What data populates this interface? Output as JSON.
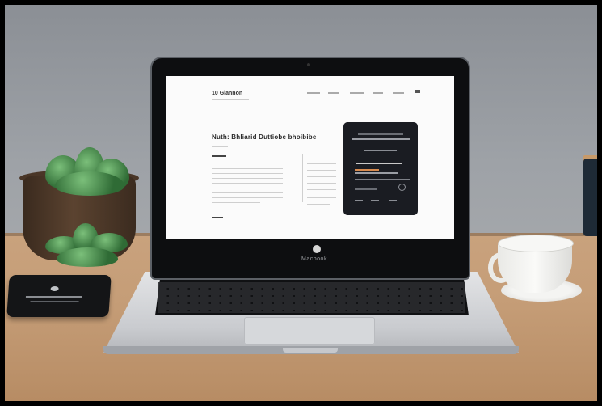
{
  "screen_page": {
    "logo": "10 Giannon",
    "heading": "Nuth: Bhliarid Duttiobe bhoibibe",
    "subhead": "Dhbabe"
  },
  "laptop": {
    "brand_text": "Macbook"
  },
  "colors": {
    "desk": "#c59d77",
    "wall": "#9ea2a7",
    "card_dark": "#1a1c22",
    "plant": "#3f7f43"
  },
  "icons": [
    "camera-icon",
    "apple-logo-icon",
    "menu-icon"
  ]
}
